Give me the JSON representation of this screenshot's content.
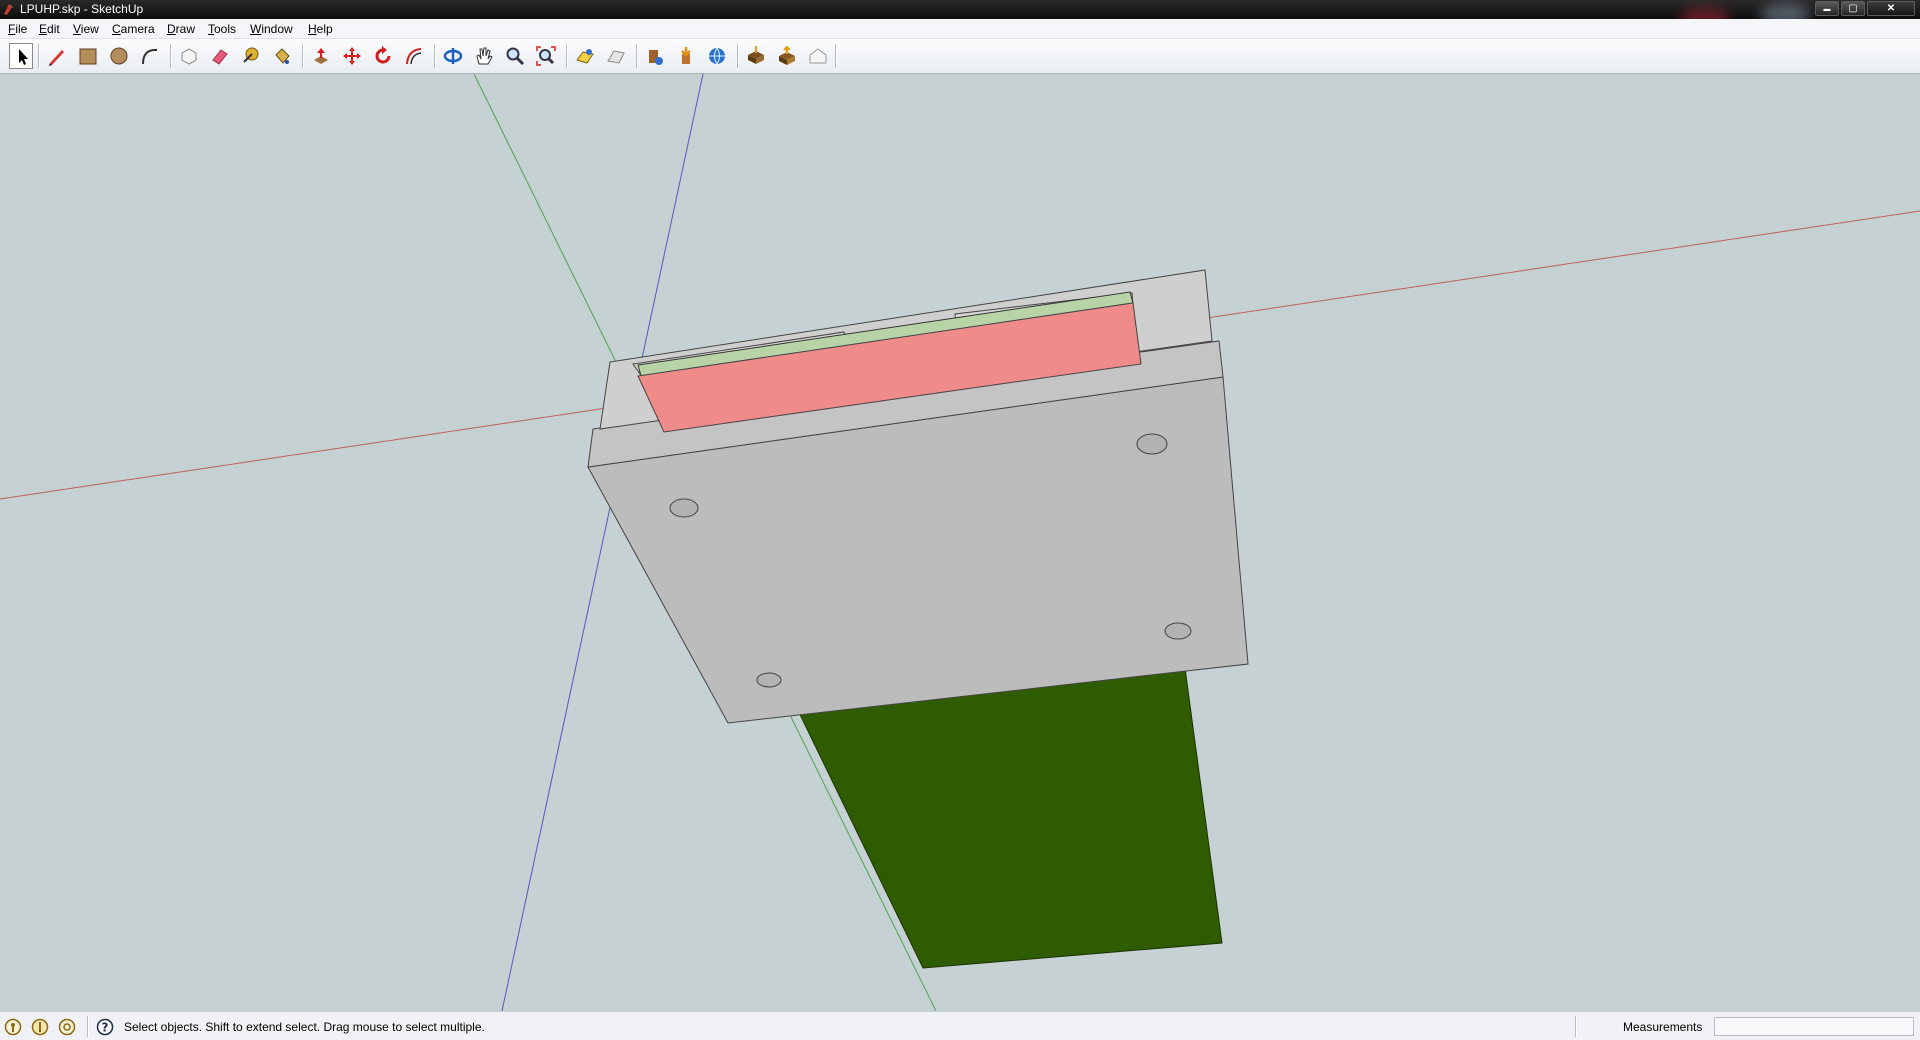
{
  "window": {
    "title": "LPUHP.skp - SketchUp",
    "minimize_glyph": "▬",
    "maximize_glyph": "▢",
    "close_glyph": "✕"
  },
  "menu": [
    {
      "label": "File"
    },
    {
      "label": "Edit"
    },
    {
      "label": "View"
    },
    {
      "label": "Camera"
    },
    {
      "label": "Draw"
    },
    {
      "label": "Tools"
    },
    {
      "label": "Window"
    },
    {
      "label": "Help"
    }
  ],
  "toolbar": {
    "active_tool": "select",
    "groups": [
      [
        "select-tool",
        "pencil-line-tool",
        "rectangle-tool",
        "circle-tool",
        "arc-tool"
      ],
      [
        "make-component-tool",
        "eraser-tool",
        "tape-measure-tool",
        "paint-bucket-tool"
      ],
      [
        "push-pull-tool",
        "move-tool",
        "rotate-tool",
        "offset-tool"
      ],
      [
        "orbit-tool",
        "pan-tool",
        "zoom-tool",
        "zoom-extents-tool"
      ],
      [
        "add-location-tool",
        "toggle-terrain-tool"
      ],
      [
        "preview-in-google-earth-tool",
        "get-models-tool",
        "share-model-tool"
      ],
      [
        "get-components-tool",
        "share-component-tool",
        "photo-textures-tool"
      ]
    ]
  },
  "viewport": {
    "background_color": "#c5d1d2",
    "axis_colors": {
      "red": "#c03a3a",
      "green": "#3aa03a",
      "blue": "#3b3bb8"
    },
    "model_colors": {
      "block_front": "#bcbcbc",
      "block_top": "#cfcfcf",
      "block_side": "#c2c2c2",
      "pink_face": "#ef8b89",
      "light_green_strip": "#b8d3a6",
      "dark_green_face": "#2f5c00"
    }
  },
  "status": {
    "indicator_icons": [
      "geo-location-icon",
      "credits-icon",
      "user-account-icon"
    ],
    "help_icon": "question-mark-icon",
    "message": "Select objects. Shift to extend select. Drag mouse to select multiple.",
    "measurements_label": "Measurements",
    "measurements_value": ""
  }
}
